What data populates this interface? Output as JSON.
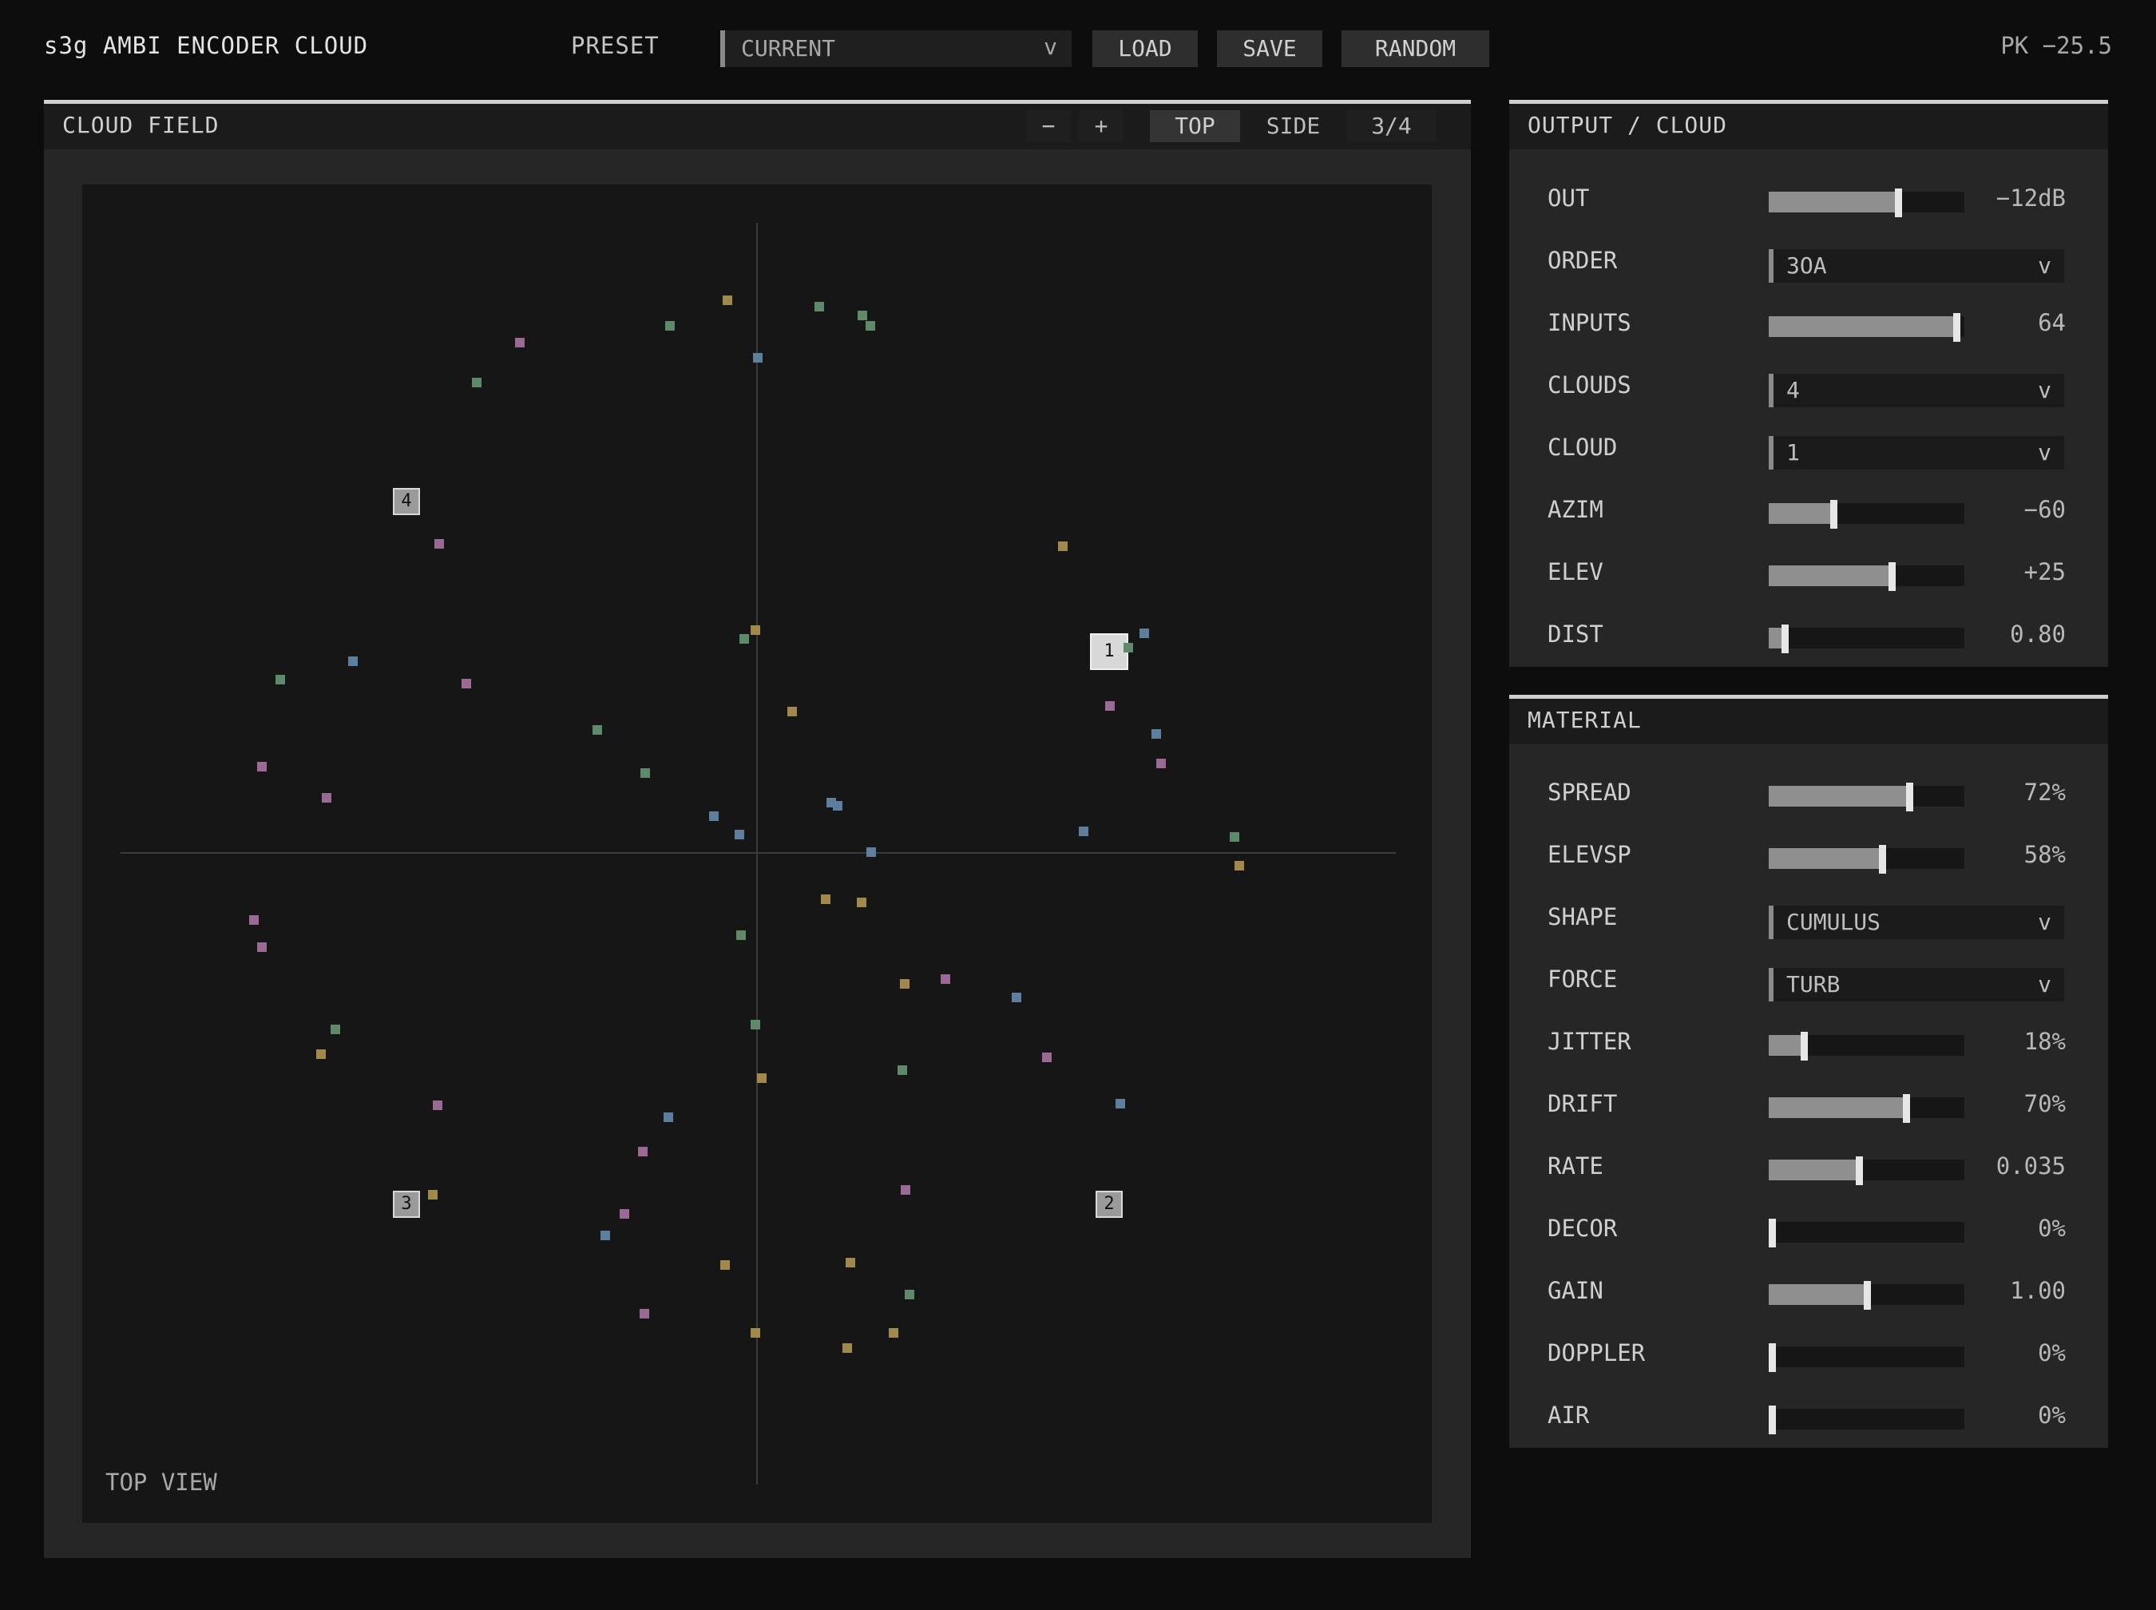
{
  "app": {
    "title": "s3g AMBI ENCODER CLOUD",
    "peak": "PK −25.5"
  },
  "toolbar": {
    "preset_label": "PRESET",
    "preset_value": "CURRENT",
    "caret": "v",
    "load": "LOAD",
    "save": "SAVE",
    "random": "RANDOM"
  },
  "field": {
    "title": "CLOUD FIELD",
    "zoom_out": "−",
    "zoom_in": "+",
    "view_top": "TOP",
    "view_side": "SIDE",
    "view_three_quarter": "3/4",
    "active_view": "TOP",
    "view_label": "TOP VIEW",
    "markers": [
      "1",
      "2",
      "3",
      "4"
    ],
    "active_marker": "1",
    "colors": {
      "green": "#5e8a6a",
      "purple": "#9a6a94",
      "blue": "#5e7e9e",
      "olive": "#a0894a"
    }
  },
  "output": {
    "title": "OUTPUT / CLOUD",
    "rows": [
      {
        "label": "OUT",
        "type": "slider",
        "value": "−12dB",
        "level": 0.66
      },
      {
        "label": "ORDER",
        "type": "select",
        "value": "3OA"
      },
      {
        "label": "INPUTS",
        "type": "slider",
        "value": "64",
        "level": 0.96
      },
      {
        "label": "CLOUDS",
        "type": "select",
        "value": "4"
      },
      {
        "label": "CLOUD",
        "type": "select",
        "value": "1"
      },
      {
        "label": "AZIM",
        "type": "slider",
        "value": "−60",
        "level": 0.33
      },
      {
        "label": "ELEV",
        "type": "slider",
        "value": "+25",
        "level": 0.63
      },
      {
        "label": "DIST",
        "type": "slider",
        "value": "0.80",
        "level": 0.08
      }
    ]
  },
  "material": {
    "title": "MATERIAL",
    "rows": [
      {
        "label": "SPREAD",
        "type": "slider",
        "value": "72%",
        "level": 0.72
      },
      {
        "label": "ELEVSP",
        "type": "slider",
        "value": "58%",
        "level": 0.58
      },
      {
        "label": "SHAPE",
        "type": "select",
        "value": "CUMULUS"
      },
      {
        "label": "FORCE",
        "type": "select",
        "value": "TURB"
      },
      {
        "label": "JITTER",
        "type": "slider",
        "value": "18%",
        "level": 0.18
      },
      {
        "label": "DRIFT",
        "type": "slider",
        "value": "70%",
        "level": 0.7
      },
      {
        "label": "RATE",
        "type": "slider",
        "value": "0.035",
        "level": 0.46
      },
      {
        "label": "DECOR",
        "type": "slider",
        "value": "0%",
        "level": 0
      },
      {
        "label": "GAIN",
        "type": "slider",
        "value": "1.00",
        "level": 0.5
      },
      {
        "label": "DOPPLER",
        "type": "slider",
        "value": "0%",
        "level": 0
      },
      {
        "label": "AIR",
        "type": "slider",
        "value": "0%",
        "level": 0
      }
    ]
  }
}
